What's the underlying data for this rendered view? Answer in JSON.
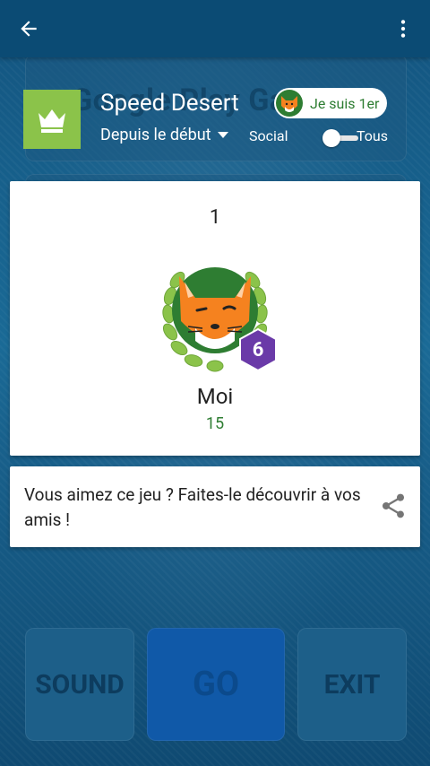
{
  "colors": {
    "appbar": "#0b4b74",
    "accent_green": "#8bc34a",
    "score_green": "#2e7d32",
    "level_badge": "#6a3aa8",
    "go_button": "#1059a8"
  },
  "appbar": {
    "back_icon": "arrow-back-icon",
    "more_icon": "more-vert-icon"
  },
  "background": {
    "title_ghost": "Google Play Games"
  },
  "leaderboard": {
    "title": "Speed Desert",
    "period": "Depuis le début",
    "me_chip_label": "Je suis 1er",
    "social_label": "Social",
    "all_label": "Tous",
    "toggle_state": "social"
  },
  "player": {
    "rank": "1",
    "name": "Moi",
    "score": "15",
    "level": "6"
  },
  "share": {
    "text": "Vous aimez ce jeu ? Faites-le découvrir à vos amis !"
  },
  "game_buttons": {
    "sound": "SOUND",
    "go": "GO",
    "exit": "EXIT"
  }
}
